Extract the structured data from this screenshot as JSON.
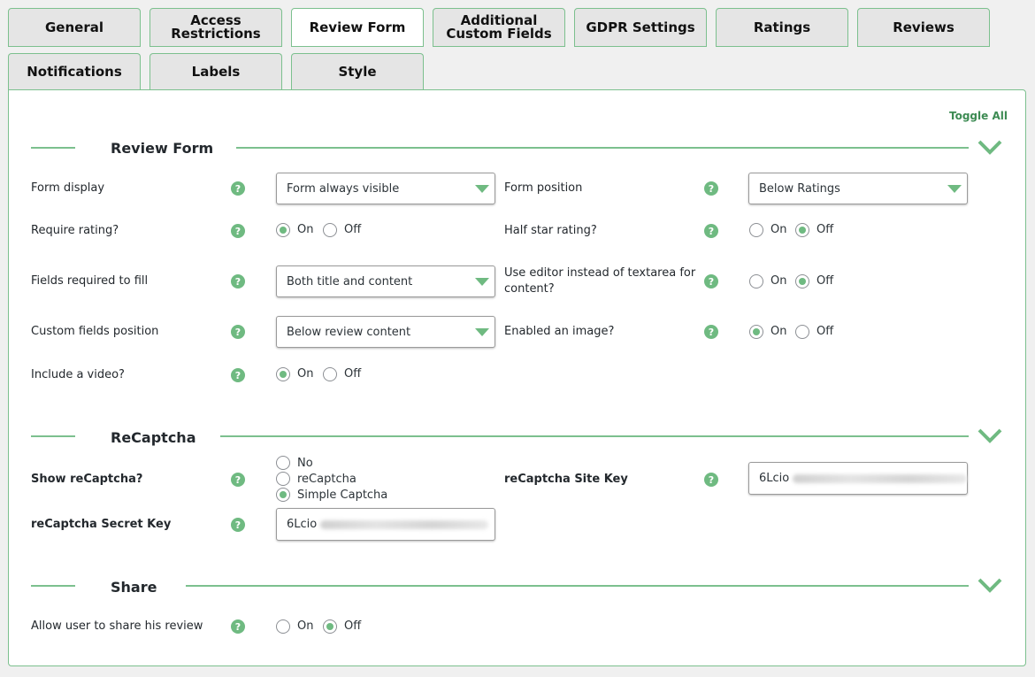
{
  "tabs": [
    "General",
    "Access Restrictions",
    "Review Form",
    "Additional Custom Fields",
    "GDPR Settings",
    "Ratings",
    "Reviews",
    "Notifications",
    "Labels",
    "Style"
  ],
  "active_tab": "Review Form",
  "toggle_all": "Toggle All",
  "sections": {
    "review_form": {
      "title": "Review Form",
      "form_display": {
        "label": "Form display",
        "value": "Form always visible"
      },
      "form_position": {
        "label": "Form position",
        "value": "Below Ratings"
      },
      "require_rating": {
        "label": "Require rating?",
        "on": "On",
        "off": "Off",
        "selected": "On"
      },
      "half_star": {
        "label": "Half star rating?",
        "on": "On",
        "off": "Off",
        "selected": "Off"
      },
      "fields_required": {
        "label": "Fields required to fill",
        "value": "Both title and content"
      },
      "use_editor": {
        "label_line1": "Use editor instead of textarea for",
        "label_line2": "content?",
        "on": "On",
        "off": "Off",
        "selected": "Off"
      },
      "custom_fields_position": {
        "label": "Custom fields position",
        "value": "Below review content"
      },
      "enable_image": {
        "label": "Enabled an image?",
        "on": "On",
        "off": "Off",
        "selected": "On"
      },
      "include_video": {
        "label": "Include a video?",
        "on": "On",
        "off": "Off",
        "selected": "On"
      }
    },
    "recaptcha": {
      "title": "ReCaptcha",
      "show": {
        "label": "Show reCaptcha?",
        "options": [
          "No",
          "reCaptcha",
          "Simple Captcha"
        ],
        "selected": "Simple Captcha"
      },
      "site_key": {
        "label": "reCaptcha Site Key",
        "value": "6Lcio"
      },
      "secret_key": {
        "label": "reCaptcha Secret Key",
        "value": "6Lcio"
      }
    },
    "share": {
      "title": "Share",
      "allow_share": {
        "label": "Allow user to share his review",
        "on": "On",
        "off": "Off",
        "selected": "Off"
      }
    }
  },
  "help_glyph": "?",
  "colors": {
    "accent": "#6fba81",
    "border": "#7cc08e",
    "link": "#3d8b53"
  }
}
